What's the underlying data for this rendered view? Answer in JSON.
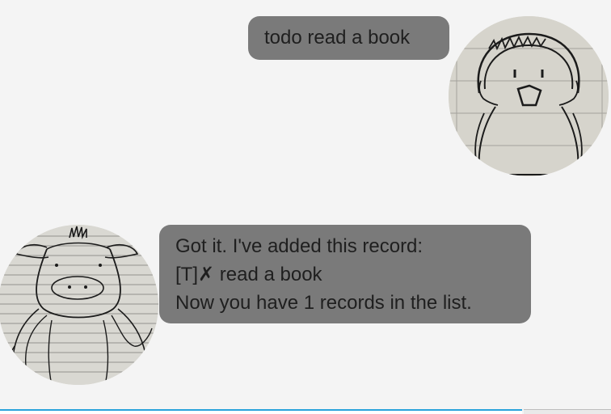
{
  "messages": {
    "user": {
      "text": "todo read a book",
      "avatar": "penguin-sketch-avatar"
    },
    "bot": {
      "line1": "Got it. I've added this record:",
      "line2_prefix": "[T]",
      "line2_mark": "✗",
      "line2_text": " read a book",
      "line3": "Now you have 1 records in the list.",
      "avatar": "pig-sketch-avatar"
    }
  },
  "input": {
    "value": "",
    "accent_color": "#29a3db"
  },
  "colors": {
    "background": "#f4f4f4",
    "bubble": "#7a7a7a",
    "text": "#1f1f1f"
  }
}
